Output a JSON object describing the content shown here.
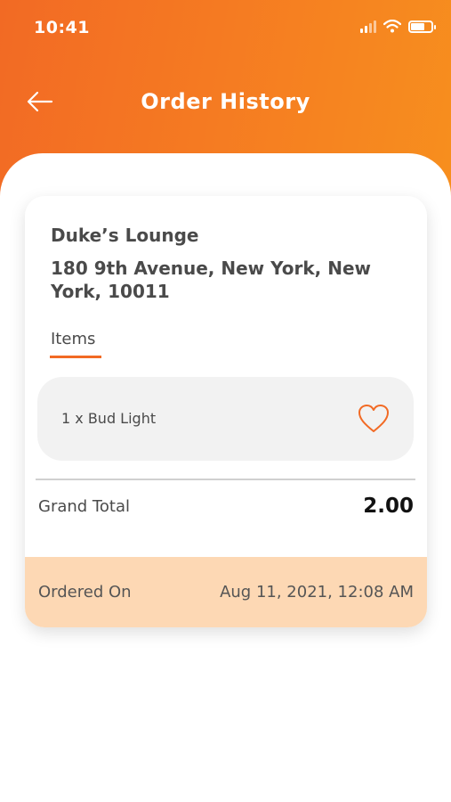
{
  "status_bar": {
    "time": "10:41"
  },
  "header": {
    "title": "Order History",
    "back_icon": "arrow-left-icon"
  },
  "order": {
    "venue_name": "Duke’s Lounge",
    "venue_address": "180 9th Avenue, New York, New York, 10011",
    "items_tab_label": "Items",
    "items": [
      {
        "text": "1 x Bud Light",
        "icon": "heart-outline-icon"
      }
    ],
    "grand_total_label": "Grand Total",
    "grand_total_value": "2.00",
    "ordered_on_label": "Ordered On",
    "ordered_on_value": "Aug 11, 2021, 12:08 AM"
  },
  "colors": {
    "accent": "#f26a24",
    "accent_light": "#fdd8b4",
    "item_bg": "#f2f2f2",
    "text": "#4a4a4a"
  }
}
